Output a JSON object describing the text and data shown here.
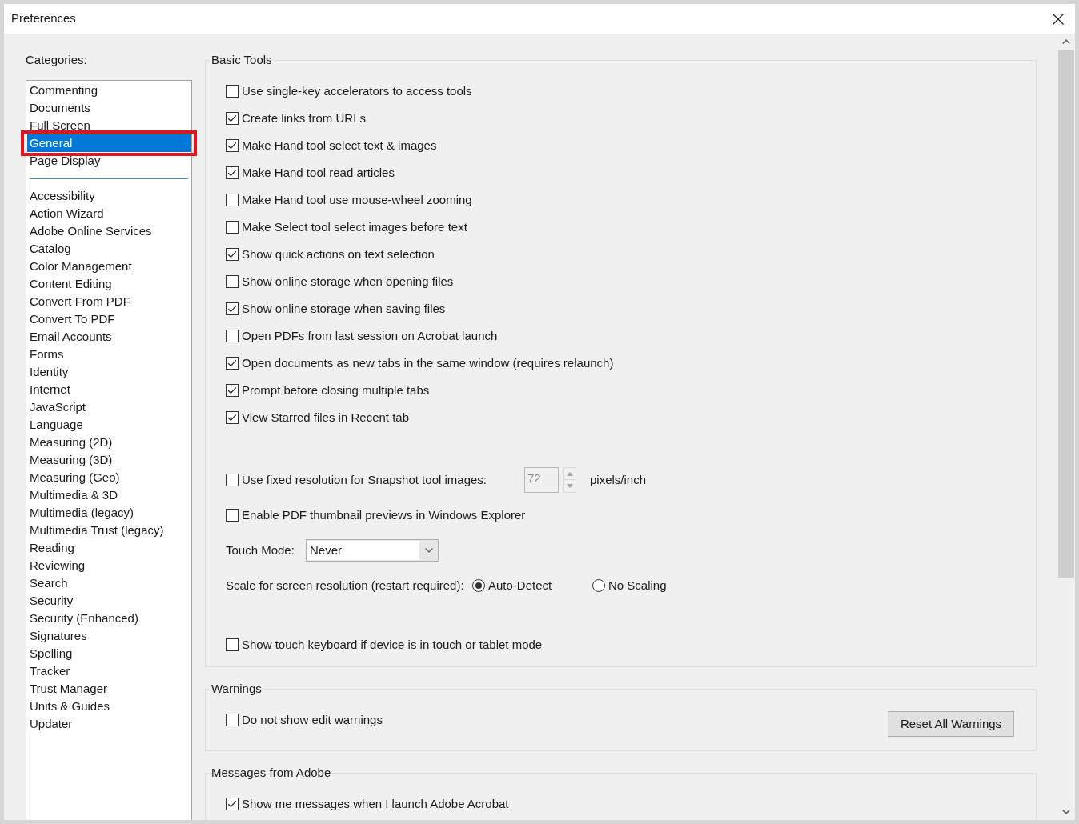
{
  "window": {
    "title": "Preferences"
  },
  "categories": {
    "label": "Categories:",
    "groups": [
      {
        "items": [
          {
            "label": "Commenting",
            "selected": false,
            "highlighted": false
          },
          {
            "label": "Documents",
            "selected": false,
            "highlighted": false
          },
          {
            "label": "Full Screen",
            "selected": false,
            "highlighted": false
          },
          {
            "label": "General",
            "selected": true,
            "highlighted": true
          },
          {
            "label": "Page Display",
            "selected": false,
            "highlighted": false
          }
        ]
      },
      {
        "items": [
          {
            "label": "Accessibility",
            "selected": false,
            "highlighted": false
          },
          {
            "label": "Action Wizard",
            "selected": false,
            "highlighted": false
          },
          {
            "label": "Adobe Online Services",
            "selected": false,
            "highlighted": false
          },
          {
            "label": "Catalog",
            "selected": false,
            "highlighted": false
          },
          {
            "label": "Color Management",
            "selected": false,
            "highlighted": false
          },
          {
            "label": "Content Editing",
            "selected": false,
            "highlighted": false
          },
          {
            "label": "Convert From PDF",
            "selected": false,
            "highlighted": false
          },
          {
            "label": "Convert To PDF",
            "selected": false,
            "highlighted": false
          },
          {
            "label": "Email Accounts",
            "selected": false,
            "highlighted": false
          },
          {
            "label": "Forms",
            "selected": false,
            "highlighted": false
          },
          {
            "label": "Identity",
            "selected": false,
            "highlighted": false
          },
          {
            "label": "Internet",
            "selected": false,
            "highlighted": false
          },
          {
            "label": "JavaScript",
            "selected": false,
            "highlighted": false
          },
          {
            "label": "Language",
            "selected": false,
            "highlighted": false
          },
          {
            "label": "Measuring (2D)",
            "selected": false,
            "highlighted": false
          },
          {
            "label": "Measuring (3D)",
            "selected": false,
            "highlighted": false
          },
          {
            "label": "Measuring (Geo)",
            "selected": false,
            "highlighted": false
          },
          {
            "label": "Multimedia & 3D",
            "selected": false,
            "highlighted": false
          },
          {
            "label": "Multimedia (legacy)",
            "selected": false,
            "highlighted": false
          },
          {
            "label": "Multimedia Trust (legacy)",
            "selected": false,
            "highlighted": false
          },
          {
            "label": "Reading",
            "selected": false,
            "highlighted": false
          },
          {
            "label": "Reviewing",
            "selected": false,
            "highlighted": false
          },
          {
            "label": "Search",
            "selected": false,
            "highlighted": false
          },
          {
            "label": "Security",
            "selected": false,
            "highlighted": false
          },
          {
            "label": "Security (Enhanced)",
            "selected": false,
            "highlighted": false
          },
          {
            "label": "Signatures",
            "selected": false,
            "highlighted": false
          },
          {
            "label": "Spelling",
            "selected": false,
            "highlighted": false
          },
          {
            "label": "Tracker",
            "selected": false,
            "highlighted": false
          },
          {
            "label": "Trust Manager",
            "selected": false,
            "highlighted": false
          },
          {
            "label": "Units & Guides",
            "selected": false,
            "highlighted": false
          },
          {
            "label": "Updater",
            "selected": false,
            "highlighted": false
          }
        ]
      }
    ]
  },
  "sections": [
    {
      "title": "Basic Tools",
      "blocks": [
        {
          "items": [
            {
              "kind": "checkbox",
              "label": "Use single-key accelerators to access tools",
              "checked": false
            },
            {
              "kind": "checkbox",
              "label": "Create links from URLs",
              "checked": true
            },
            {
              "kind": "checkbox",
              "label": "Make Hand tool select text & images",
              "checked": true
            },
            {
              "kind": "checkbox",
              "label": "Make Hand tool read articles",
              "checked": true
            },
            {
              "kind": "checkbox",
              "label": "Make Hand tool use mouse-wheel zooming",
              "checked": false
            },
            {
              "kind": "checkbox",
              "label": "Make Select tool select images before text",
              "checked": false
            },
            {
              "kind": "checkbox",
              "label": "Show quick actions on text selection",
              "checked": true
            },
            {
              "kind": "checkbox",
              "label": "Show online storage when opening files",
              "checked": false
            },
            {
              "kind": "checkbox",
              "label": "Show online storage when saving files",
              "checked": true
            },
            {
              "kind": "checkbox",
              "label": "Open PDFs from last session on Acrobat launch",
              "checked": false
            },
            {
              "kind": "checkbox",
              "label": "Open documents as new tabs in the same window (requires relaunch)",
              "checked": true
            },
            {
              "kind": "checkbox",
              "label": "Prompt before closing multiple tabs",
              "checked": true
            },
            {
              "kind": "checkbox",
              "label": "View Starred files in Recent tab",
              "checked": true
            }
          ]
        },
        {
          "items": [
            {
              "kind": "checkbox-spin",
              "label": "Use fixed resolution for Snapshot tool images:",
              "checked": false,
              "field": {
                "value": "72",
                "disabled": true
              },
              "unit": "pixels/inch"
            },
            {
              "kind": "checkbox",
              "label": "Enable PDF thumbnail previews in Windows Explorer",
              "checked": false
            },
            {
              "kind": "select",
              "label": "Touch Mode:",
              "value": "Never"
            },
            {
              "kind": "radio-group",
              "label": "Scale for screen resolution (restart required):",
              "options": [
                {
                  "label": "Auto-Detect",
                  "selected": true
                },
                {
                  "label": "No Scaling",
                  "selected": false
                }
              ]
            }
          ]
        },
        {
          "items": [
            {
              "kind": "checkbox",
              "label": "Show touch keyboard if device is in touch or tablet mode",
              "checked": false
            }
          ]
        }
      ]
    },
    {
      "title": "Warnings",
      "blocks": [
        {
          "items": [
            {
              "kind": "checkbox",
              "label": "Do not show edit warnings",
              "checked": false
            }
          ]
        }
      ],
      "button": "Reset All Warnings"
    },
    {
      "title": "Messages from Adobe",
      "blocks": [
        {
          "items": [
            {
              "kind": "checkbox",
              "label": "Show me messages when I launch Adobe Acrobat",
              "checked": true
            }
          ]
        }
      ]
    }
  ]
}
